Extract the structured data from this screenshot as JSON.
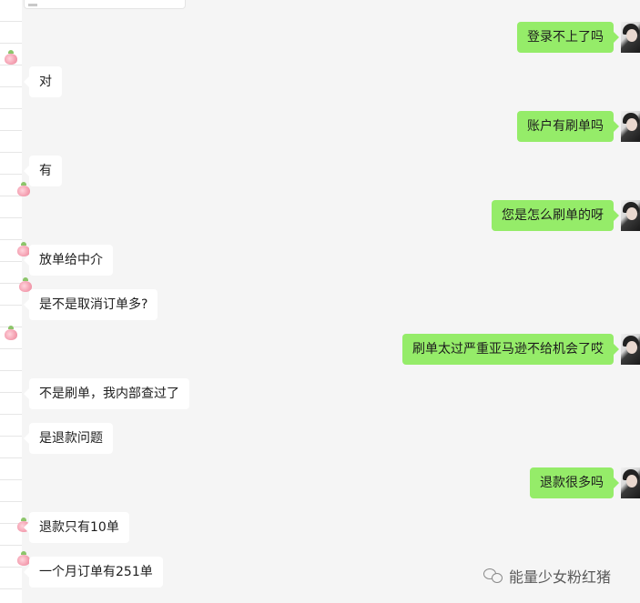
{
  "chat": {
    "messages": [
      {
        "side": "right",
        "text": "登录不上了吗"
      },
      {
        "side": "left",
        "text": "对"
      },
      {
        "side": "right",
        "text": "账户有刷单吗"
      },
      {
        "side": "left",
        "text": "有"
      },
      {
        "side": "right",
        "text": "您是怎么刷单的呀"
      },
      {
        "side": "left",
        "text": "放单给中介"
      },
      {
        "side": "left",
        "text": "是不是取消订单多?"
      },
      {
        "side": "right",
        "text": "刷单太过严重亚马逊不给机会了哎"
      },
      {
        "side": "left",
        "text": "不是刷单，我内部查过了"
      },
      {
        "side": "left",
        "text": "是退款问题"
      },
      {
        "side": "right",
        "text": "退款很多吗"
      },
      {
        "side": "left",
        "text": "退款只有10单"
      },
      {
        "side": "left",
        "text": "一个月订单有251单"
      }
    ]
  },
  "watermark": {
    "text": "能量少女粉红猪",
    "icon": "wechat-official-account-icon"
  },
  "colors": {
    "sent_bubble": "#95ec69",
    "received_bubble": "#ffffff",
    "background": "#f5f5f5"
  }
}
